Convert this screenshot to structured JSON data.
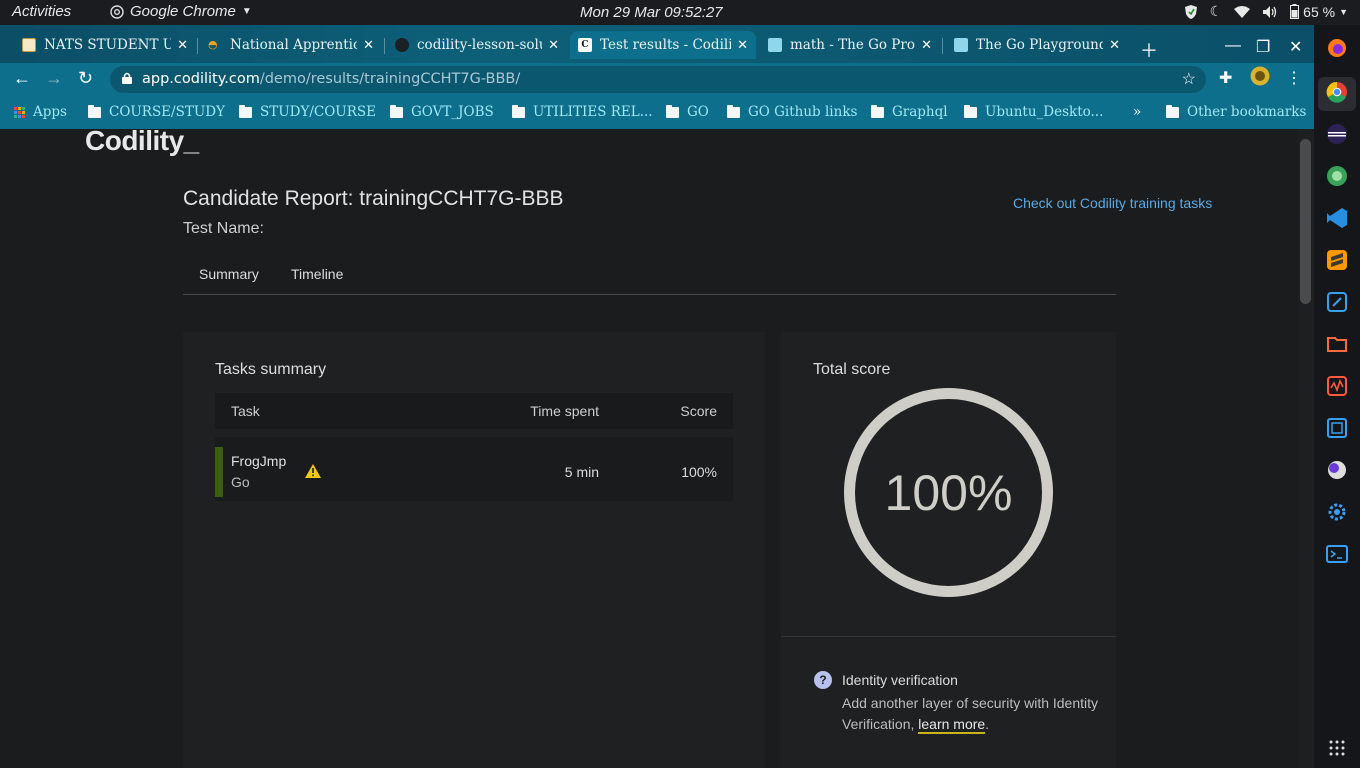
{
  "system": {
    "activities": "Activities",
    "app_name": "Google Chrome",
    "clock": "Mon 29 Mar  09:52:27",
    "battery": "65 %"
  },
  "browser": {
    "tabs": [
      {
        "label": "NATS STUDENT US",
        "active": false
      },
      {
        "label": "National Apprentice",
        "active": false
      },
      {
        "label": "codility-lesson-solu",
        "active": false
      },
      {
        "label": "Test results - Codili",
        "active": true
      },
      {
        "label": "math - The Go Prog",
        "active": false
      },
      {
        "label": "The Go Playground",
        "active": false
      }
    ],
    "url_host": "app.codility.com",
    "url_path": "/demo/results/trainingCCHT7G-BBB/",
    "bookmarks": [
      "Apps",
      "COURSE/STUDY",
      "STUDY/COURSE",
      "GOVT_JOBS",
      "UTILITIES REL...",
      "GO",
      "GO Github links",
      "Graphql",
      "Ubuntu_Deskto...",
      "Other bookmarks"
    ],
    "overflow": "»"
  },
  "page": {
    "logo": "Codility_",
    "report_title": "Candidate Report:  trainingCCHT7G-BBB",
    "test_name_label": "Test Name:",
    "training_link": "Check out Codility training tasks",
    "tabs": [
      "Summary",
      "Timeline"
    ],
    "tasks_summary": {
      "title": "Tasks summary",
      "headers": [
        "Task",
        "Time spent",
        "Score"
      ],
      "rows": [
        {
          "task": "FrogJmp",
          "language": "Go",
          "time": "5 min",
          "score": "100%"
        }
      ]
    },
    "total_score": {
      "title": "Total score",
      "value": "100%",
      "fraction": 1.0
    },
    "identity": {
      "title": "Identity verification",
      "text": "Add another layer of security with Identity Verification,",
      "link": "learn more",
      "end": "."
    }
  },
  "colors": {
    "accent_link": "#5aa9e6",
    "task_bar": "#3d5d10",
    "warning": "#f2c811",
    "ring": "#cfcdc7"
  }
}
